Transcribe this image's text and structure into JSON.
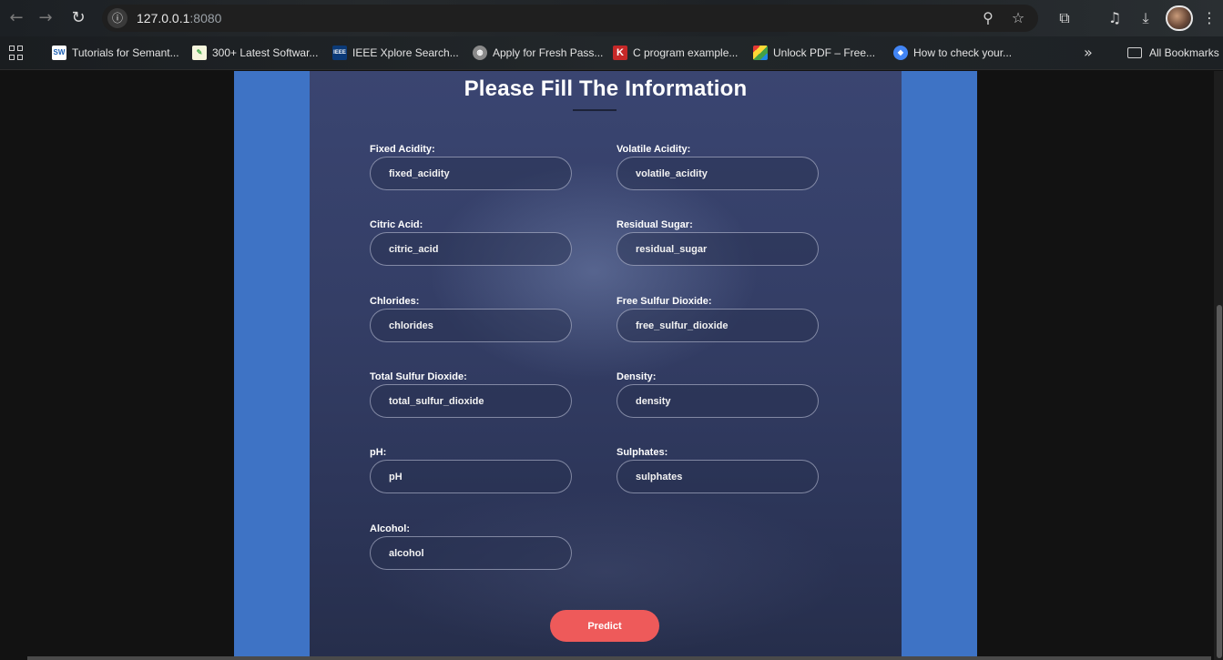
{
  "browser": {
    "url_host": "127.0.0.1",
    "url_port": ":8080",
    "bookmarks": [
      {
        "label": "Tutorials for Semant...",
        "icon": "sw-favicon",
        "badge": "SW",
        "color": "#ffffff",
        "text_color": "#1a5fb4"
      },
      {
        "label": "300+ Latest Softwar...",
        "icon": "leaf-favicon",
        "badge": "",
        "color": "#f5f5dc",
        "text_color": "#4caf50"
      },
      {
        "label": "IEEE Xplore Search...",
        "icon": "ieee-favicon",
        "badge": "IEEE",
        "color": "#0b3a78",
        "text_color": "#ffffff"
      },
      {
        "label": "Apply for Fresh Pass...",
        "icon": "globe-favicon",
        "badge": "",
        "color": "#8a8a8a",
        "text_color": "#ffffff"
      },
      {
        "label": "C program example...",
        "icon": "k-favicon",
        "badge": "K",
        "color": "#c62828",
        "text_color": "#ffffff"
      },
      {
        "label": "Unlock PDF – Free...",
        "icon": "colorgrid-favicon",
        "badge": "",
        "color": "#e53935",
        "text_color": "#ffffff"
      },
      {
        "label": "How to check your...",
        "icon": "shield-favicon",
        "badge": "",
        "color": "#4285f4",
        "text_color": "#ffffff"
      }
    ],
    "all_bookmarks": "All Bookmarks"
  },
  "form": {
    "title": "Please Fill The Information",
    "fields": [
      {
        "label": "Fixed Acidity:",
        "placeholder": "fixed_acidity"
      },
      {
        "label": "Volatile Acidity:",
        "placeholder": "volatile_acidity"
      },
      {
        "label": "Citric Acid:",
        "placeholder": "citric_acid"
      },
      {
        "label": "Residual Sugar:",
        "placeholder": "residual_sugar"
      },
      {
        "label": "Chlorides:",
        "placeholder": "chlorides"
      },
      {
        "label": "Free Sulfur Dioxide:",
        "placeholder": "free_sulfur_dioxide"
      },
      {
        "label": "Total Sulfur Dioxide:",
        "placeholder": "total_sulfur_dioxide"
      },
      {
        "label": "Density:",
        "placeholder": "density"
      },
      {
        "label": "pH:",
        "placeholder": "pH"
      },
      {
        "label": "Sulphates:",
        "placeholder": "sulphates"
      },
      {
        "label": "Alcohol:",
        "placeholder": "alcohol"
      }
    ],
    "submit_label": "Predict"
  },
  "colors": {
    "frame": "#3e73c5",
    "panel": "#343e66",
    "button": "#ee5a5a"
  }
}
